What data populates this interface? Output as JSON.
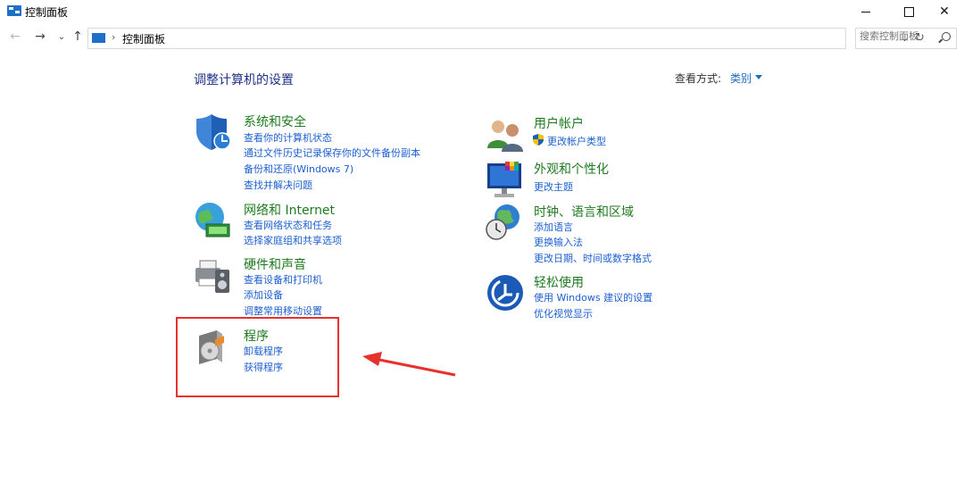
{
  "window": {
    "title": "控制面板"
  },
  "address": {
    "crumb": "控制面板",
    "search_placeholder": "搜索控制面板"
  },
  "main": {
    "heading": "调整计算机的设置",
    "view_by_label": "查看方式:",
    "view_by_value": "类别"
  },
  "categories": {
    "system": {
      "title": "系统和安全",
      "links": [
        "查看你的计算机状态",
        "通过文件历史记录保存你的文件备份副本",
        "备份和还原(Windows 7)",
        "查找并解决问题"
      ]
    },
    "network": {
      "title": "网络和 Internet",
      "links": [
        "查看网络状态和任务",
        "选择家庭组和共享选项"
      ]
    },
    "hardware": {
      "title": "硬件和声音",
      "links": [
        "查看设备和打印机",
        "添加设备",
        "调整常用移动设置"
      ]
    },
    "programs": {
      "title": "程序",
      "links": [
        "卸载程序",
        "获得程序"
      ]
    },
    "users": {
      "title": "用户帐户",
      "links": [
        "更改帐户类型"
      ]
    },
    "appearance": {
      "title": "外观和个性化",
      "links": [
        "更改主题"
      ]
    },
    "clock": {
      "title": "时钟、语言和区域",
      "links": [
        "添加语言",
        "更换输入法",
        "更改日期、时间或数字格式"
      ]
    },
    "ease": {
      "title": "轻松使用",
      "links": [
        "使用 Windows 建议的设置",
        "优化视觉显示"
      ]
    }
  },
  "colors": {
    "title_green": "#1e7a1e",
    "link_blue": "#1c5fd1",
    "heading_blue": "#1e3287",
    "highlight_red": "#e5322d"
  }
}
